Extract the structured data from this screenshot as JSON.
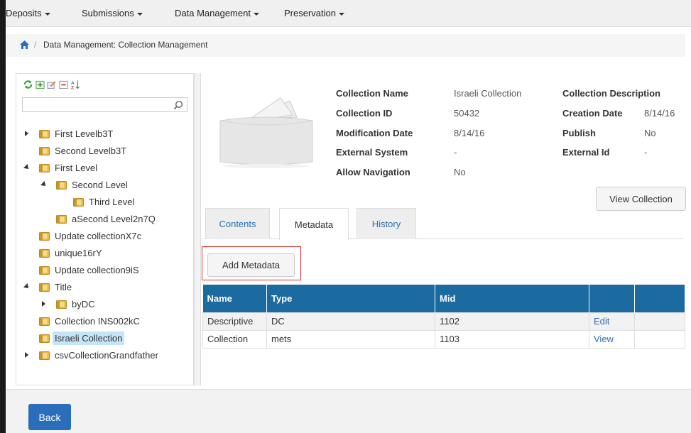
{
  "nav": {
    "items": [
      "Deposits",
      "Submissions",
      "Data Management",
      "Preservation"
    ]
  },
  "breadcrumb": {
    "separator": "/",
    "current": "Data Management: Collection Management"
  },
  "tree": {
    "nodes": [
      {
        "label": "First Levelb3T",
        "toggle": "collapsed"
      },
      {
        "label": "Second Levelb3T",
        "toggle": "none"
      },
      {
        "label": "First Level",
        "toggle": "expanded"
      },
      {
        "label": "Second Level",
        "toggle": "expanded"
      },
      {
        "label": "Third Level",
        "toggle": "none"
      },
      {
        "label": "aSecond Level2n7Q",
        "toggle": "none"
      },
      {
        "label": "Update collectionX7c",
        "toggle": "none"
      },
      {
        "label": "unique16rY",
        "toggle": "none"
      },
      {
        "label": "Update collection9iS",
        "toggle": "none"
      },
      {
        "label": "Title",
        "toggle": "expanded"
      },
      {
        "label": "byDC",
        "toggle": "collapsed"
      },
      {
        "label": "Collection INS002kC",
        "toggle": "none"
      },
      {
        "label": "Israeli Collection",
        "toggle": "none",
        "selected": true
      },
      {
        "label": "csvCollectionGrandfather",
        "toggle": "collapsed"
      }
    ]
  },
  "details": {
    "collection_name_label": "Collection Name",
    "collection_name_value": "Israeli Collection",
    "collection_id_label": "Collection ID",
    "collection_id_value": "50432",
    "modification_date_label": "Modification Date",
    "modification_date_value": "8/14/16",
    "external_system_label": "External System",
    "external_system_value": "-",
    "allow_navigation_label": "Allow Navigation",
    "allow_navigation_value": "No",
    "collection_description_label": "Collection Description",
    "creation_date_label": "Creation Date",
    "creation_date_value": "8/14/16",
    "publish_label": "Publish",
    "publish_value": "No",
    "external_id_label": "External Id",
    "external_id_value": "-"
  },
  "buttons": {
    "view_collection": "View Collection",
    "add_metadata": "Add Metadata",
    "back": "Back"
  },
  "tabs": [
    "Contents",
    "Metadata",
    "History"
  ],
  "metadata_table": {
    "headers": [
      "Name",
      "Type",
      "Mid",
      "",
      ""
    ],
    "rows": [
      [
        "Descriptive",
        "DC",
        "1102",
        "Edit",
        ""
      ],
      [
        "Collection",
        "mets",
        "1103",
        "View",
        ""
      ]
    ]
  },
  "colors": {
    "header_blue": "#1b6aa0",
    "link_blue": "#2a6ebb",
    "selection": "#c4e4f7",
    "highlight_red": "#e03030"
  }
}
